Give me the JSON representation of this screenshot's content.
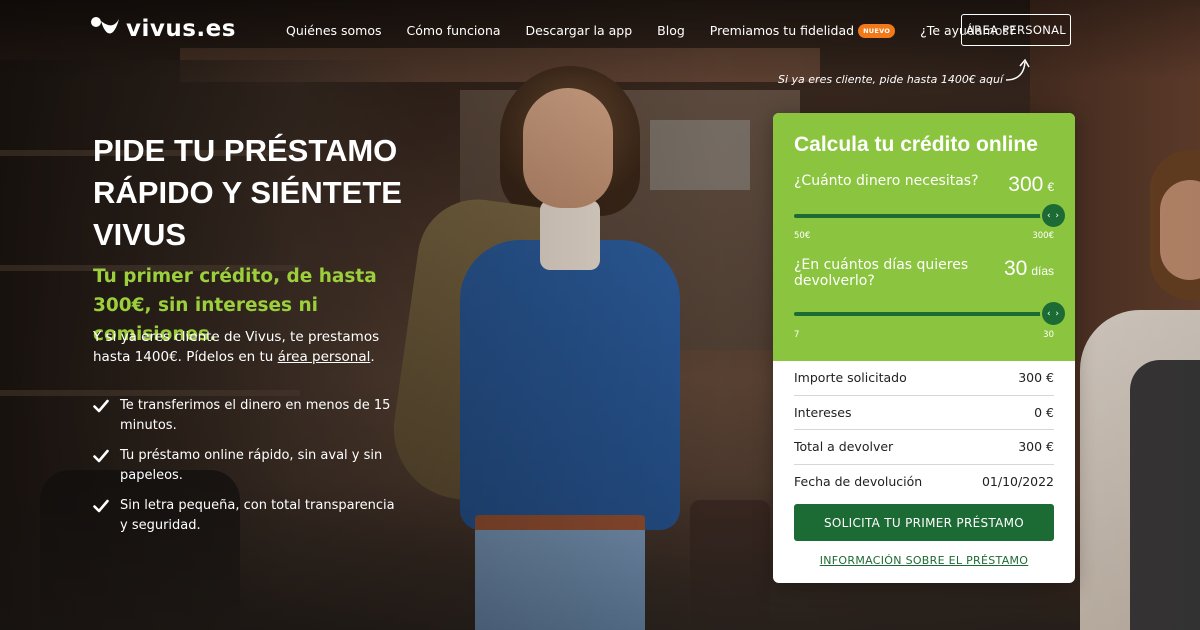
{
  "header": {
    "logo_text": "vivus.es",
    "nav": [
      {
        "label": "Quiénes somos"
      },
      {
        "label": "Cómo funciona"
      },
      {
        "label": "Descargar la app"
      },
      {
        "label": "Blog"
      },
      {
        "label": "Premiamos tu fidelidad",
        "badge": "NUEVO"
      },
      {
        "label": "¿Te ayudamos?"
      }
    ],
    "area_button": "ÁREA PERSONAL",
    "area_hint": "Si ya eres cliente, pide hasta 1400€ aquí"
  },
  "hero": {
    "title": "PIDE TU PRÉSTAMO RÁPIDO Y SIÉNTETE VIVUS",
    "subtitle": "Tu primer crédito, de hasta 300€, sin intereses ni comisiones.",
    "desc_prefix": "Y si ya eres cliente de Vivus, te prestamos hasta 1400€. Pídelos en tu ",
    "desc_link": "área personal",
    "desc_suffix": ".",
    "benefits": [
      "Te transferimos el dinero en menos de 15 minutos.",
      "Tu préstamo online rápido, sin aval y sin papeleos.",
      "Sin letra pequeña, con total transparencia y seguridad."
    ]
  },
  "calculator": {
    "title": "Calcula tu crédito online",
    "amount": {
      "label": "¿Cuánto dinero necesitas?",
      "value": "300",
      "unit": "€",
      "min_label": "50€",
      "max_label": "300€",
      "thumb_glyph": "‹ ›"
    },
    "days": {
      "label": "¿En cuántos días quieres devolverlo?",
      "value": "30",
      "unit": "días",
      "min_label": "7",
      "max_label": "30",
      "thumb_glyph": "‹ ›"
    },
    "summary": [
      {
        "label": "Importe solicitado",
        "value": "300 €"
      },
      {
        "label": "Intereses",
        "value": "0 €"
      },
      {
        "label": "Total a devolver",
        "value": "300 €"
      },
      {
        "label": "Fecha de devolución",
        "value": "01/10/2022"
      }
    ],
    "cta": "SOLICITA TU PRIMER PRÉSTAMO",
    "info_link": "INFORMACIÓN SOBRE EL PRÉSTAMO"
  },
  "colors": {
    "brand_green": "#8bc53f",
    "dark_green": "#1d6b34",
    "badge_orange": "#f07a1a"
  }
}
